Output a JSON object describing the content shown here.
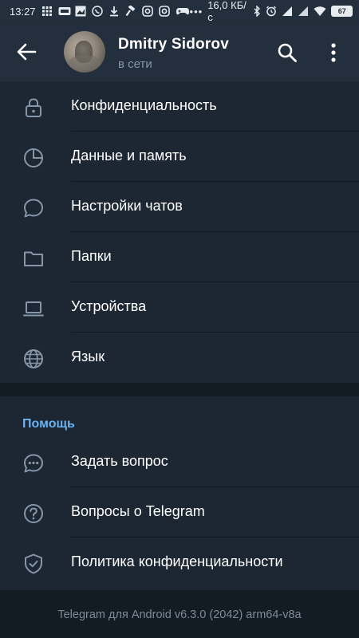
{
  "status_bar": {
    "time": "13:27",
    "network_speed": "16,0 КБ/с",
    "battery_level": "67",
    "icons": [
      "grid-icon",
      "vpn-icon",
      "image-icon",
      "viber-icon",
      "download-icon",
      "hammer-icon",
      "instagram-icon",
      "instagram-icon",
      "gamepad-icon",
      "more-dots-icon",
      "bluetooth-icon",
      "alarm-icon",
      "signal-icon",
      "signal-icon",
      "wifi-icon",
      "battery-icon"
    ]
  },
  "header": {
    "back_icon": "arrow-left-icon",
    "name": "Dmitry Sidorov",
    "status": "в сети",
    "search_icon": "search-icon",
    "more_icon": "more-vertical-icon"
  },
  "settings": {
    "items": [
      {
        "label": "Конфиденциальность",
        "icon": "lock-icon"
      },
      {
        "label": "Данные и память",
        "icon": "pie-chart-icon"
      },
      {
        "label": "Настройки чатов",
        "icon": "chat-bubble-icon"
      },
      {
        "label": "Папки",
        "icon": "folder-icon"
      },
      {
        "label": "Устройства",
        "icon": "laptop-icon"
      },
      {
        "label": "Язык",
        "icon": "globe-icon"
      }
    ]
  },
  "help": {
    "title": "Помощь",
    "items": [
      {
        "label": "Задать вопрос",
        "icon": "chat-dots-icon"
      },
      {
        "label": "Вопросы о Telegram",
        "icon": "question-circle-icon"
      },
      {
        "label": "Политика конфиденциальности",
        "icon": "shield-check-icon"
      }
    ]
  },
  "footer": {
    "version_text": "Telegram для Android v6.3.0 (2042) arm64-v8a"
  },
  "colors": {
    "background": "#1d2733",
    "header": "#242f3d",
    "accent": "#6ab2f2",
    "secondary_text": "#8596a8"
  }
}
